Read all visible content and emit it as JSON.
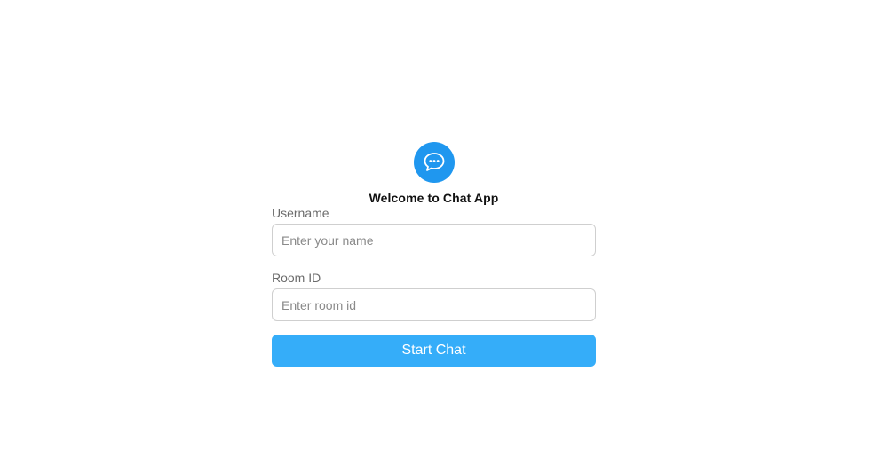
{
  "app": {
    "title": "Welcome to Chat App",
    "logo_icon": "chat-bubbles-icon",
    "accent_color": "#1f97ef",
    "button_color": "#35adf9"
  },
  "form": {
    "username_label": "Username",
    "username_placeholder": "Enter your name",
    "username_value": "",
    "room_label": "Room ID",
    "room_placeholder": "Enter room id",
    "room_value": "",
    "submit_label": "Start Chat"
  }
}
